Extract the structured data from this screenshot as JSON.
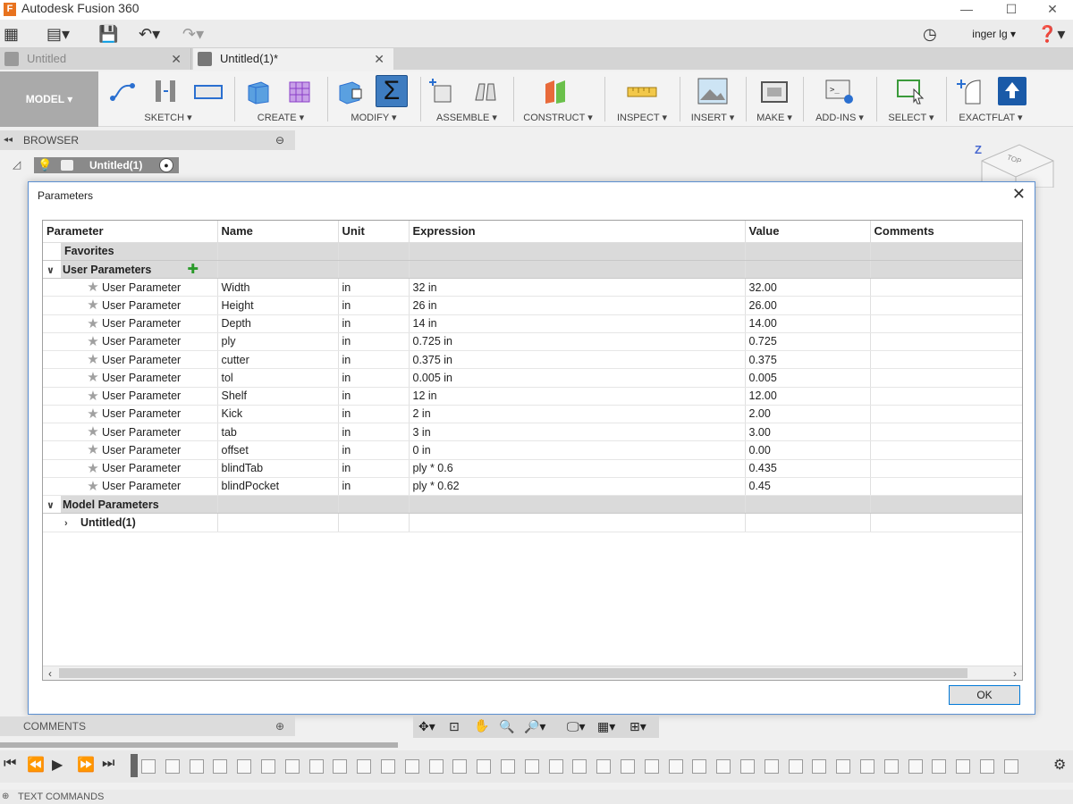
{
  "app": {
    "title": "Autodesk Fusion 360",
    "user": "inger lg"
  },
  "tabs": [
    {
      "label": "Untitled"
    },
    {
      "label": "Untitled(1)*"
    }
  ],
  "ribbon": {
    "workspace": "MODEL",
    "groups": [
      {
        "label": "SKETCH ▾"
      },
      {
        "label": "CREATE ▾"
      },
      {
        "label": "MODIFY ▾"
      },
      {
        "label": "ASSEMBLE ▾"
      },
      {
        "label": "CONSTRUCT ▾"
      },
      {
        "label": "INSPECT ▾"
      },
      {
        "label": "INSERT ▾"
      },
      {
        "label": "MAKE ▾"
      },
      {
        "label": "ADD-INS ▾"
      },
      {
        "label": "SELECT ▾"
      },
      {
        "label": "EXACTFLAT ▾"
      }
    ]
  },
  "browser": {
    "label": "BROWSER",
    "root": "Untitled(1)"
  },
  "viewcube": {
    "top": "TOP",
    "axis": "Z"
  },
  "dialog": {
    "title": "Parameters",
    "columns": [
      "Parameter",
      "Name",
      "Unit",
      "Expression",
      "Value",
      "Comments"
    ],
    "favorites_label": "Favorites",
    "user_params_label": "User Parameters",
    "model_params_label": "Model Parameters",
    "model_child": "Untitled(1)",
    "rows": [
      {
        "type": "User Parameter",
        "name": "Width",
        "unit": "in",
        "expression": "32 in",
        "value": "32.00"
      },
      {
        "type": "User Parameter",
        "name": "Height",
        "unit": "in",
        "expression": "26 in",
        "value": "26.00"
      },
      {
        "type": "User Parameter",
        "name": "Depth",
        "unit": "in",
        "expression": "14 in",
        "value": "14.00"
      },
      {
        "type": "User Parameter",
        "name": "ply",
        "unit": "in",
        "expression": "0.725 in",
        "value": "0.725"
      },
      {
        "type": "User Parameter",
        "name": "cutter",
        "unit": "in",
        "expression": "0.375 in",
        "value": "0.375"
      },
      {
        "type": "User Parameter",
        "name": "tol",
        "unit": "in",
        "expression": "0.005 in",
        "value": "0.005"
      },
      {
        "type": "User Parameter",
        "name": "Shelf",
        "unit": "in",
        "expression": "12 in",
        "value": "12.00"
      },
      {
        "type": "User Parameter",
        "name": "Kick",
        "unit": "in",
        "expression": "2 in",
        "value": "2.00"
      },
      {
        "type": "User Parameter",
        "name": "tab",
        "unit": "in",
        "expression": "3 in",
        "value": "3.00"
      },
      {
        "type": "User Parameter",
        "name": "offset",
        "unit": "in",
        "expression": "0 in",
        "value": "0.00"
      },
      {
        "type": "User Parameter",
        "name": "blindTab",
        "unit": "in",
        "expression": "ply * 0.6",
        "value": "0.435"
      },
      {
        "type": "User Parameter",
        "name": "blindPocket",
        "unit": "in",
        "expression": "ply * 0.62",
        "value": "0.45"
      }
    ],
    "ok_label": "OK"
  },
  "comments": {
    "label": "COMMENTS"
  },
  "textcommands": {
    "label": "TEXT COMMANDS"
  },
  "colors": {
    "accent": "#5b8fd1",
    "modify_active": "#2f6db5",
    "ok_border": "#0078d7"
  }
}
